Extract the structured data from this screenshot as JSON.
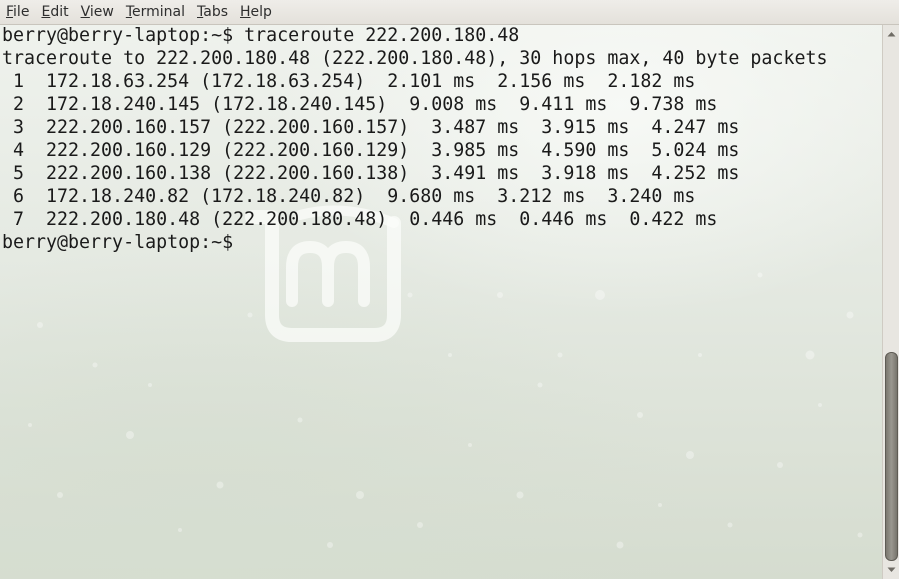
{
  "menubar": {
    "items": [
      {
        "mnemonic": "F",
        "rest": "ile"
      },
      {
        "mnemonic": "E",
        "rest": "dit"
      },
      {
        "mnemonic": "V",
        "rest": "iew"
      },
      {
        "mnemonic": "T",
        "rest": "erminal"
      },
      {
        "mnemonic": "T",
        "rest": "abs"
      },
      {
        "mnemonic": "H",
        "rest": "elp"
      }
    ]
  },
  "terminal": {
    "lines": [
      "berry@berry-laptop:~$ traceroute 222.200.180.48",
      "traceroute to 222.200.180.48 (222.200.180.48), 30 hops max, 40 byte packets",
      " 1  172.18.63.254 (172.18.63.254)  2.101 ms  2.156 ms  2.182 ms",
      " 2  172.18.240.145 (172.18.240.145)  9.008 ms  9.411 ms  9.738 ms",
      " 3  222.200.160.157 (222.200.160.157)  3.487 ms  3.915 ms  4.247 ms",
      " 4  222.200.160.129 (222.200.160.129)  3.985 ms  4.590 ms  5.024 ms",
      " 5  222.200.160.138 (222.200.160.138)  3.491 ms  3.918 ms  4.252 ms",
      " 6  172.18.240.82 (172.18.240.82)  9.680 ms  3.212 ms  3.240 ms",
      " 7  222.200.180.48 (222.200.180.48)  0.446 ms  0.446 ms  0.422 ms",
      "berry@berry-laptop:~$ "
    ],
    "wallpaper_icon": "linux-mint-logo-icon"
  },
  "scrollbar": {
    "up_icon": "arrow-up-icon",
    "down_icon": "arrow-down-icon",
    "position": 0.88
  },
  "colors": {
    "text": "#1a1a1a",
    "menubar_bg": "#e9e7e2",
    "scroll_thumb": "#8a877f"
  }
}
